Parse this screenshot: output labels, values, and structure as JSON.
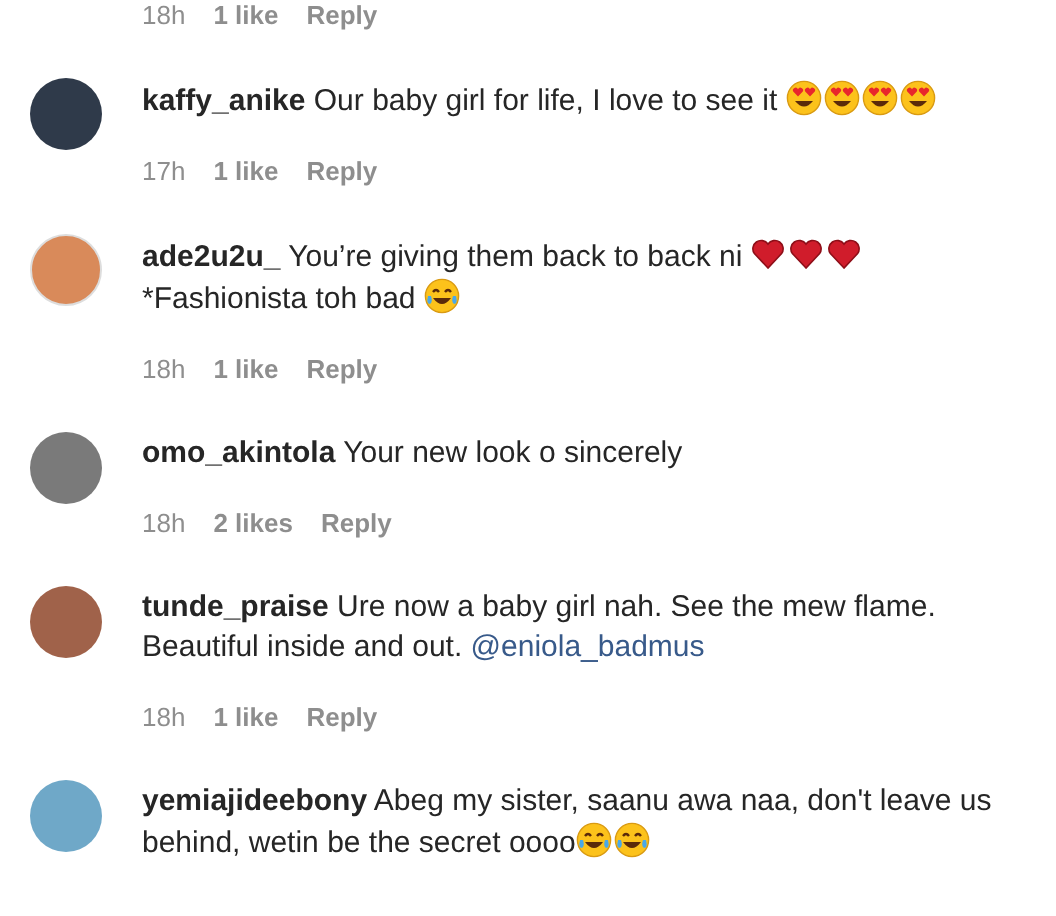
{
  "top_meta": {
    "time": "18h",
    "likes": "1 like",
    "reply": "Reply"
  },
  "comments": [
    {
      "username": "kaffy_anike",
      "parts": [
        {
          "kind": "text",
          "text": "Our baby girl for life, I love to see it "
        },
        {
          "kind": "heart-eyes"
        },
        {
          "kind": "heart-eyes"
        },
        {
          "kind": "heart-eyes"
        },
        {
          "kind": "heart-eyes"
        }
      ],
      "time": "17h",
      "likes": "1 like",
      "reply": "Reply"
    },
    {
      "username": "ade2u2u_",
      "parts": [
        {
          "kind": "text",
          "text": "You’re giving them back to back ni "
        },
        {
          "kind": "heart"
        },
        {
          "kind": "heart"
        },
        {
          "kind": "heart"
        },
        {
          "kind": "break"
        },
        {
          "kind": "text",
          "text": "*Fashionista toh bad "
        },
        {
          "kind": "laughing"
        }
      ],
      "time": "18h",
      "likes": "1 like",
      "reply": "Reply"
    },
    {
      "username": "omo_akintola",
      "parts": [
        {
          "kind": "text",
          "text": "Your new look o sincerely"
        }
      ],
      "time": "18h",
      "likes": "2 likes",
      "reply": "Reply"
    },
    {
      "username": "tunde_praise",
      "parts": [
        {
          "kind": "text",
          "text": "Ure now a baby girl nah. See the mew flame. Beautiful inside and out. "
        },
        {
          "kind": "mention",
          "text": "@eniola_badmus"
        }
      ],
      "time": "18h",
      "likes": "1 like",
      "reply": "Reply"
    },
    {
      "username": "yemiajideebony",
      "parts": [
        {
          "kind": "text",
          "text": "Abeg my sister, saanu awa naa, don't leave us behind, wetin be the secret oooo"
        },
        {
          "kind": "laughing"
        },
        {
          "kind": "laughing"
        }
      ]
    }
  ]
}
